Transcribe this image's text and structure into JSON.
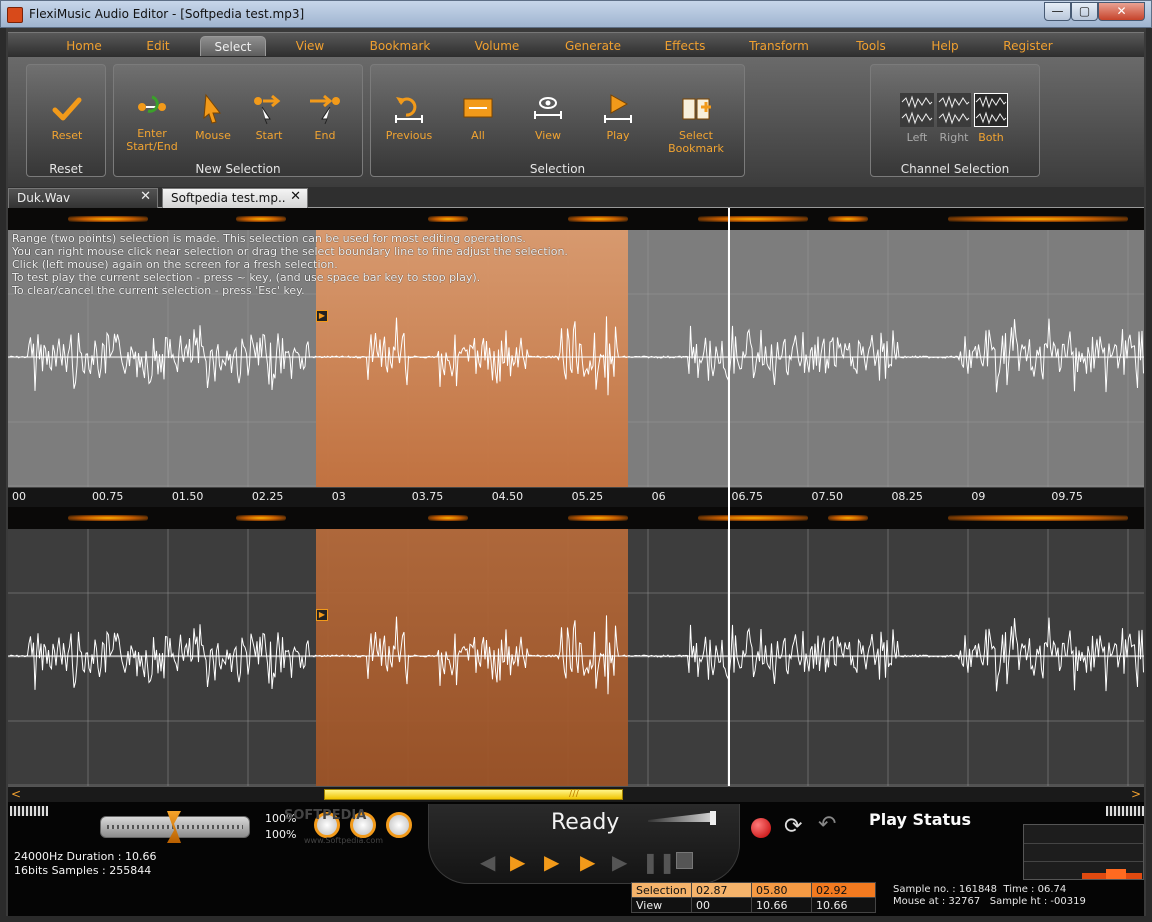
{
  "window": {
    "title": "FlexiMusic Audio Editor - [Softpedia test.mp3]",
    "min_symbol": "—",
    "max_symbol": "▢",
    "close_symbol": "✕"
  },
  "menu": {
    "items": [
      "Home",
      "Edit",
      "Select",
      "View",
      "Bookmark",
      "Volume",
      "Generate",
      "Effects",
      "Transform",
      "Tools",
      "Help",
      "Register"
    ],
    "active": "Select"
  },
  "ribbon": {
    "groups": {
      "reset": {
        "label": "Reset",
        "tools": [
          "Reset"
        ]
      },
      "new_selection": {
        "label": "New Selection",
        "tools": [
          "Enter Start/End",
          "Mouse",
          "Start",
          "End"
        ]
      },
      "selection": {
        "label": "Selection",
        "tools": [
          "Previous",
          "All",
          "View",
          "Play",
          "Select Bookmark"
        ]
      },
      "channel": {
        "label": "Channel Selection",
        "tools": [
          "Left",
          "Right",
          "Both"
        ],
        "active": "Both"
      }
    },
    "tool_text": {
      "reset": "Reset",
      "enter_line1": "Enter",
      "enter_line2": "Start/End",
      "mouse": "Mouse",
      "start": "Start",
      "end": "End",
      "previous": "Previous",
      "all": "All",
      "view": "View",
      "play": "Play",
      "bookmark_line1": "Select",
      "bookmark_line2": "Bookmark",
      "left": "Left",
      "right": "Right",
      "both": "Both"
    }
  },
  "doc_tabs": {
    "tab1": "Duk.Wav",
    "tab2": "Softpedia test.mp..",
    "close_symbol": "✕"
  },
  "hint": {
    "line1": "Range (two points) selection is made. This selection can be used for most editing operations.",
    "line2": "You can right mouse click near selection or drag the select boundary line to fine adjust the selection.",
    "line3": "Click (left mouse) again on the screen for a fresh selection.",
    "line4": "To test play the current selection - press ~ key, (and use space bar key to stop play).",
    "line5": "To clear/cancel the current selection - press 'Esc' key."
  },
  "timeline": {
    "ticks": [
      "00",
      "00.75",
      "01.50",
      "02.25",
      "03",
      "03.75",
      "04.50",
      "05.25",
      "06",
      "06.75",
      "07.50",
      "08.25",
      "09",
      "09.75"
    ]
  },
  "waveform": {
    "selection_start_s": 2.87,
    "selection_end_s": 5.8,
    "cursor_s": 6.74,
    "duration_s": 10.66
  },
  "scroll": {
    "left_arrow": "<",
    "right_arrow": ">",
    "thumb_mark": "///"
  },
  "bottom": {
    "volume_pct_1": "100%",
    "volume_pct_2": "100%",
    "format_line1": "24000Hz  Duration : 10.66",
    "format_line2": "16bits  Samples : 255844",
    "status": "Ready",
    "play_status": "Play Status",
    "watermark": "SOFTPEDIA",
    "watermark_url": "www.Softpedia.com"
  },
  "selection_table": {
    "row1": {
      "label": "Selection",
      "start": "02.87",
      "end": "05.80",
      "length": "02.92"
    },
    "row2": {
      "label": "View",
      "start": "00",
      "end": "10.66",
      "length": "10.66"
    }
  },
  "sample_info": {
    "line1": "Sample no. : 161848  Time : 06.74",
    "line2": "Mouse at : 32767   Sample ht : -00319"
  },
  "colors": {
    "accent_orange": "#f2a431",
    "selection_fill": "#dc9b6e",
    "record_red": "#e01515",
    "scroll_yellow": "#f0c400"
  }
}
